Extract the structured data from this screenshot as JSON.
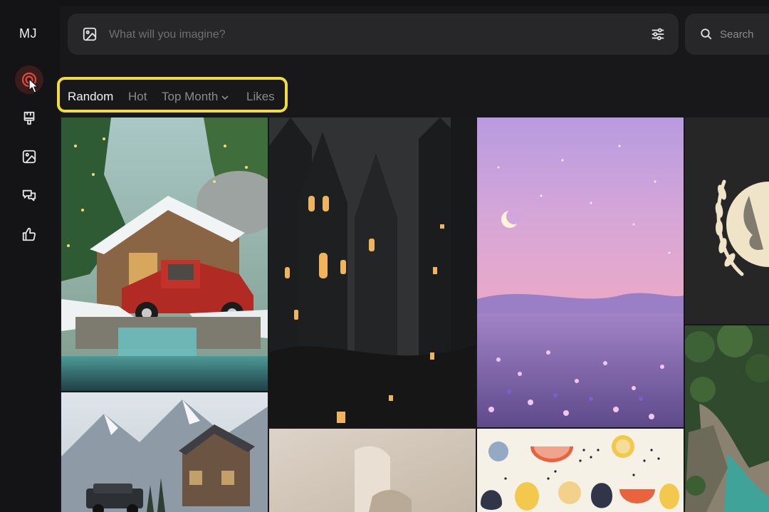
{
  "sidebar": {
    "logo": "MJ",
    "items": [
      {
        "name": "explore",
        "icon": "explore-target-icon",
        "active": true
      },
      {
        "name": "create",
        "icon": "paintbrush-icon"
      },
      {
        "name": "organize",
        "icon": "image-gallery-icon"
      },
      {
        "name": "chat",
        "icon": "chat-bubbles-icon"
      },
      {
        "name": "likes",
        "icon": "thumbs-up-icon"
      }
    ]
  },
  "prompt_bar": {
    "placeholder": "What will you imagine?",
    "left_icon": "image-icon",
    "right_icon": "sliders-icon"
  },
  "search": {
    "label": "Search",
    "icon": "search-icon"
  },
  "tabs": {
    "random": "Random",
    "hot": "Hot",
    "top_month": "Top Month",
    "likes": "Likes",
    "active": "random",
    "highlight_color": "#f2dc3b"
  },
  "gallery": {
    "images": [
      {
        "subject": "snowy cabin with red vintage truck and waterfall"
      },
      {
        "subject": "gothic dark castle city at night with lanterns"
      },
      {
        "subject": "pastel pink sky with crescent moon over wildflower field"
      },
      {
        "subject": "laurel wreath globe emblem on dark background"
      },
      {
        "subject": "snowy alpine chalet with black SUV"
      },
      {
        "subject": "beige fabric close-up"
      },
      {
        "subject": "fruit pattern illustration"
      },
      {
        "subject": "aerial forest river canyon"
      }
    ]
  },
  "colors": {
    "background": "#18181b",
    "surface": "#27272a",
    "active_nav": "#e04b3c"
  }
}
